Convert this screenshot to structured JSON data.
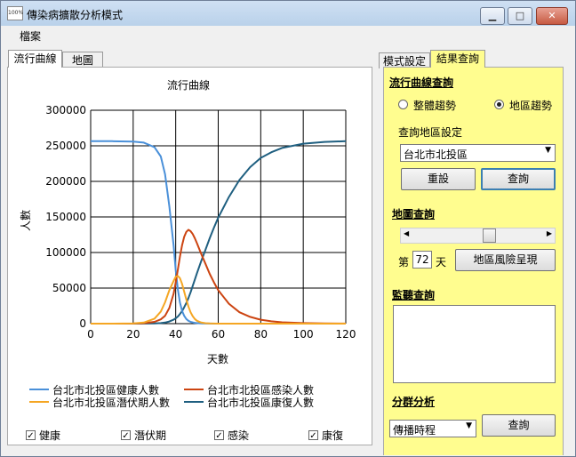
{
  "window": {
    "title": "傳染病擴散分析模式",
    "icon_text": "100%"
  },
  "menu": {
    "file": "檔案"
  },
  "left_tabs": [
    "流行曲線",
    "地圖"
  ],
  "right_tabs": [
    "模式設定",
    "結果查詢"
  ],
  "curve_query": {
    "title": "流行曲線查詢",
    "radio_overall": "整體趨勢",
    "radio_region": "地區趨勢",
    "selected": "地區趨勢",
    "region_label": "查詢地區設定",
    "region_value": "台北市北投區",
    "reset_button": "重設",
    "query_button": "查詢"
  },
  "map_query": {
    "title": "地圖查詢",
    "day_prefix": "第",
    "day_value": "72",
    "day_suffix": "天",
    "slider_fraction": 0.6,
    "render_button": "地區風險呈現"
  },
  "alert_query": {
    "title": "監聽查詢"
  },
  "cluster": {
    "title": "分群分析",
    "select_value": "傳播時程",
    "query_button": "查詢"
  },
  "checkboxes": [
    "健康",
    "潛伏期",
    "感染",
    "康復"
  ],
  "chart_data": {
    "type": "line",
    "title": "流行曲線",
    "xlabel": "天數",
    "ylabel": "人數",
    "xlim": [
      0,
      120
    ],
    "ylim": [
      0,
      300000
    ],
    "xticks": [
      0,
      20,
      40,
      60,
      80,
      100,
      120
    ],
    "yticks": [
      0,
      50000,
      100000,
      150000,
      200000,
      250000,
      300000
    ],
    "grid": true,
    "x": [
      0,
      10,
      20,
      25,
      30,
      33,
      35,
      37,
      39,
      40,
      41,
      42,
      43,
      44,
      45,
      46,
      47,
      48,
      49,
      50,
      52,
      54,
      56,
      58,
      60,
      65,
      70,
      75,
      80,
      85,
      90,
      100,
      110,
      120
    ],
    "series": [
      {
        "name": "台北市北投區健康人數",
        "color": "#4a90d9",
        "values": [
          256500,
          256500,
          256000,
          254500,
          248000,
          235000,
          210000,
          165000,
          110000,
          75000,
          48000,
          30000,
          18000,
          11000,
          6500,
          4000,
          2500,
          1700,
          1100,
          700,
          300,
          150,
          80,
          40,
          20,
          10,
          5,
          2,
          1,
          0,
          0,
          0,
          0,
          0
        ]
      },
      {
        "name": "台北市北投區感染人數",
        "color": "#cc4411",
        "values": [
          0,
          0,
          150,
          600,
          2500,
          6000,
          11000,
          22000,
          42000,
          58000,
          76000,
          94000,
          110000,
          122000,
          129000,
          132000,
          130000,
          126000,
          120000,
          113000,
          98000,
          84000,
          70000,
          58000,
          47000,
          28000,
          16000,
          9500,
          5500,
          3200,
          1900,
          700,
          250,
          100
        ]
      },
      {
        "name": "台北市北投區潛伏期人數",
        "color": "#f5a623",
        "values": [
          0,
          0,
          400,
          1500,
          7000,
          17000,
          30000,
          47000,
          60000,
          66000,
          67000,
          64000,
          56000,
          45000,
          34000,
          24000,
          16000,
          10500,
          6500,
          4000,
          1500,
          600,
          250,
          100,
          50,
          10,
          5,
          2,
          1,
          0,
          0,
          0,
          0,
          0
        ]
      },
      {
        "name": "台北市北投區康復人數",
        "color": "#1f5f80",
        "values": [
          0,
          0,
          0,
          100,
          300,
          800,
          1500,
          3000,
          5500,
          7500,
          10000,
          13500,
          17500,
          23000,
          29000,
          36000,
          44000,
          53000,
          62000,
          71000,
          88000,
          104000,
          120000,
          135000,
          149000,
          178000,
          202000,
          220000,
          233000,
          241000,
          247000,
          253000,
          255500,
          256500
        ]
      }
    ]
  }
}
